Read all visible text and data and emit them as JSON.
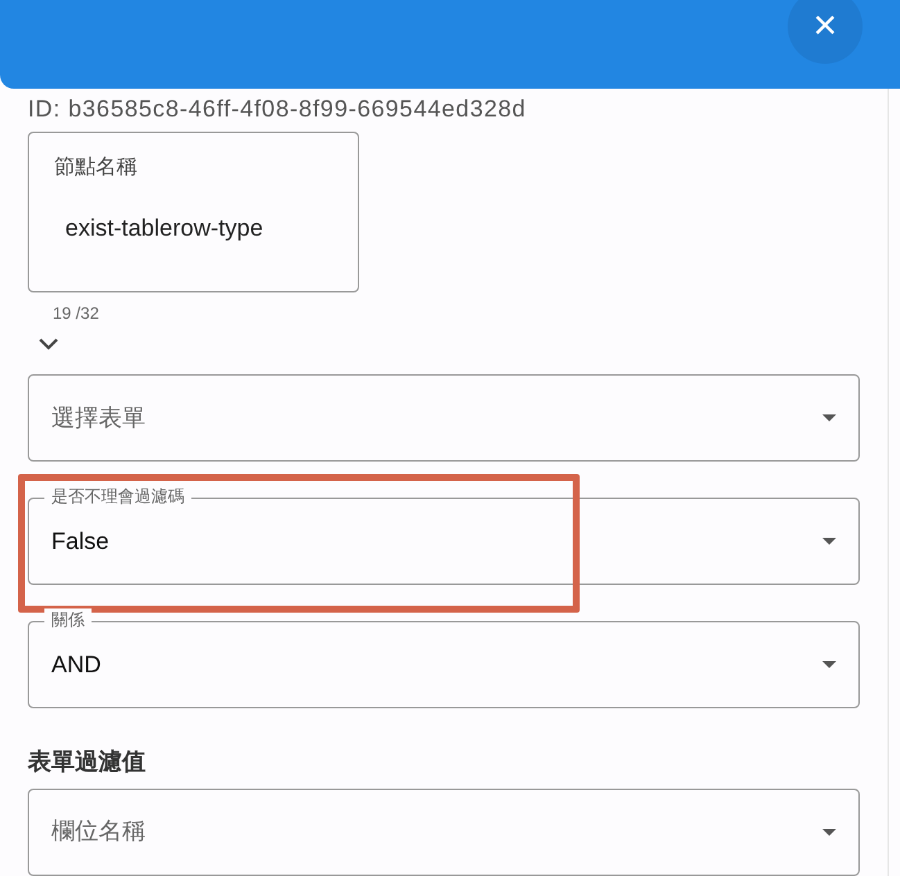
{
  "dialog": {
    "close_label": "×"
  },
  "id_text": "ID: b36585c8-46ff-4f08-8f99-669544ed328d",
  "node_name": {
    "label": "節點名稱",
    "value": "exist-tablerow-type",
    "counter": "19 /32"
  },
  "selects": [
    {
      "placeholder": "選擇表單",
      "highlighted": false
    },
    {
      "label": "是否不理會過濾碼",
      "value": "False",
      "highlighted": true
    },
    {
      "label": "關係",
      "value": "AND",
      "highlighted": false
    }
  ],
  "section_title": "表單過濾值",
  "filter_select": {
    "placeholder": "欄位名稱"
  }
}
